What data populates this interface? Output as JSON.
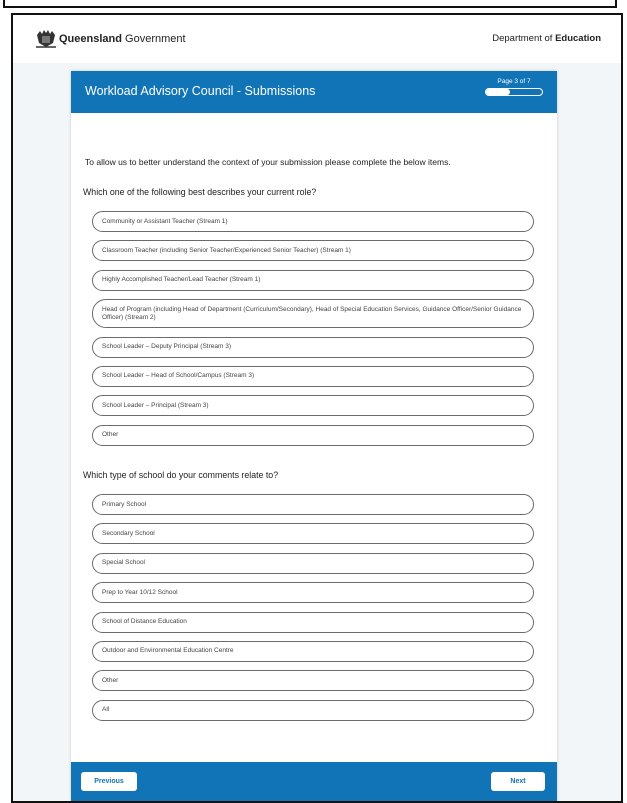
{
  "header": {
    "gov_bold": "Queensland",
    "gov_rest": " Government",
    "dept_prefix": "Department of ",
    "dept_bold": "Education"
  },
  "form": {
    "title": "Workload Advisory Council - Submissions",
    "page_indicator": "Page 3 of 7",
    "progress_fraction": 0.43,
    "intro": "To allow us to better understand the context of your submission please complete the below items.",
    "q1": {
      "label": "Which one of the following best describes your current role?",
      "options": [
        "Community or Assistant Teacher (Stream 1)",
        "Classroom Teacher (including Senior Teacher/Experienced Senior Teacher) (Stream 1)",
        "Highly Accomplished Teacher/Lead Teacher (Stream 1)",
        "Head of Program (including Head of Department (Curriculum/Secondary), Head of Special Education Services, Guidance Officer/Senior Guidance Officer) (Stream 2)",
        "School Leader – Deputy Principal (Stream 3)",
        "School Leader – Head of School/Campus (Stream 3)",
        "School Leader – Principal (Stream 3)",
        "Other"
      ]
    },
    "q2": {
      "label": "Which type of school do your comments relate to?",
      "options": [
        "Primary School",
        "Secondary School",
        "Special School",
        "Prep to Year 10/12 School",
        "School of Distance Education",
        "Outdoor and Environmental Education Centre",
        "Other",
        "All"
      ]
    },
    "buttons": {
      "previous": "Previous",
      "next": "Next"
    }
  }
}
